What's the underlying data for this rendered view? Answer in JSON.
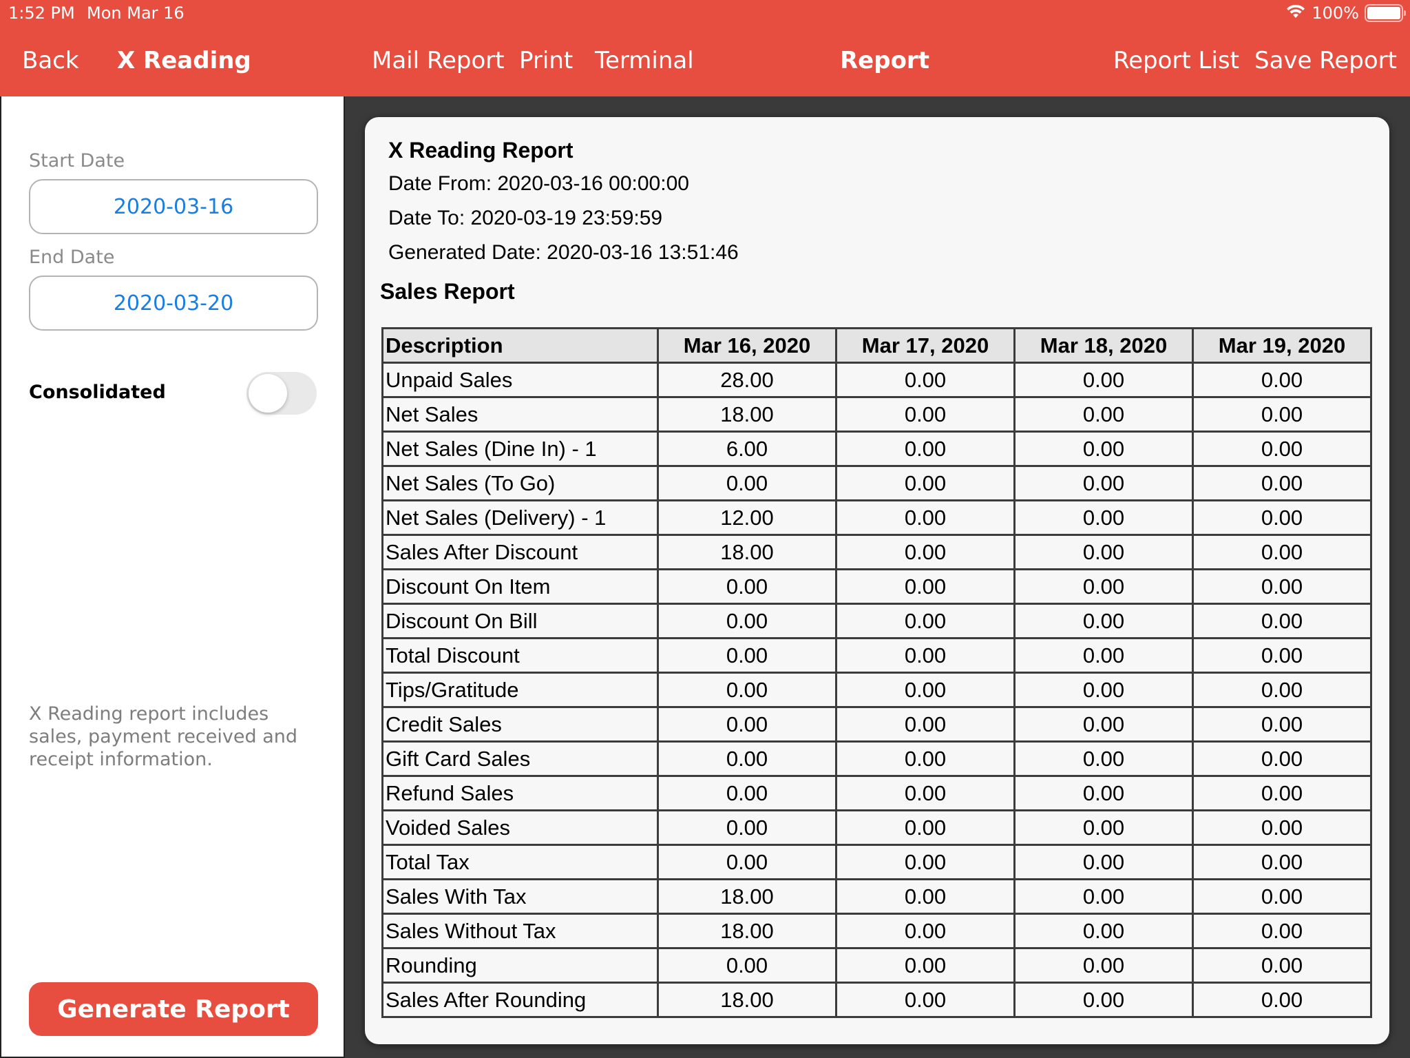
{
  "status_bar": {
    "time": "1:52 PM",
    "date": "Mon Mar 16",
    "battery": "100%",
    "battery_level_percent": 100,
    "wifi_icon": "wifi-icon",
    "battery_icon": "battery-icon"
  },
  "colors": {
    "accent": "#e84e40",
    "date_text": "#1a7ee0",
    "background_dark": "#3a3a3a"
  },
  "left_nav": {
    "back_label": "Back",
    "title": "X Reading"
  },
  "toolbar": {
    "mail_report": "Mail Report",
    "print": "Print",
    "terminal": "Terminal",
    "title": "Report",
    "report_list": "Report List",
    "save_report": "Save Report"
  },
  "left_panel": {
    "start_date_label": "Start Date",
    "start_date_value": "2020-03-16",
    "end_date_label": "End Date",
    "end_date_value": "2020-03-20",
    "consolidated_label": "Consolidated",
    "consolidated_on": false,
    "help_text": "X Reading report includes sales, payment received and receipt information.",
    "generate_button": "Generate Report"
  },
  "report": {
    "title": "X Reading Report",
    "date_from": "Date From: 2020-03-16 00:00:00",
    "date_to": "Date To: 2020-03-19 23:59:59",
    "generated": "Generated Date: 2020-03-16 13:51:46",
    "section_title": "Sales Report",
    "columns": [
      "Description",
      "Mar 16, 2020",
      "Mar 17, 2020",
      "Mar 18, 2020",
      "Mar 19, 2020"
    ],
    "rows": [
      [
        "Unpaid Sales",
        "28.00",
        "0.00",
        "0.00",
        "0.00"
      ],
      [
        "Net Sales",
        "18.00",
        "0.00",
        "0.00",
        "0.00"
      ],
      [
        "Net Sales (Dine In) - 1",
        "6.00",
        "0.00",
        "0.00",
        "0.00"
      ],
      [
        "Net Sales (To Go)",
        "0.00",
        "0.00",
        "0.00",
        "0.00"
      ],
      [
        "Net Sales (Delivery) - 1",
        "12.00",
        "0.00",
        "0.00",
        "0.00"
      ],
      [
        "Sales After Discount",
        "18.00",
        "0.00",
        "0.00",
        "0.00"
      ],
      [
        "Discount On Item",
        "0.00",
        "0.00",
        "0.00",
        "0.00"
      ],
      [
        "Discount On Bill",
        "0.00",
        "0.00",
        "0.00",
        "0.00"
      ],
      [
        "Total Discount",
        "0.00",
        "0.00",
        "0.00",
        "0.00"
      ],
      [
        "Tips/Gratitude",
        "0.00",
        "0.00",
        "0.00",
        "0.00"
      ],
      [
        "Credit Sales",
        "0.00",
        "0.00",
        "0.00",
        "0.00"
      ],
      [
        "Gift Card Sales",
        "0.00",
        "0.00",
        "0.00",
        "0.00"
      ],
      [
        "Refund Sales",
        "0.00",
        "0.00",
        "0.00",
        "0.00"
      ],
      [
        "Voided Sales",
        "0.00",
        "0.00",
        "0.00",
        "0.00"
      ],
      [
        "Total Tax",
        "0.00",
        "0.00",
        "0.00",
        "0.00"
      ],
      [
        "Sales With Tax",
        "18.00",
        "0.00",
        "0.00",
        "0.00"
      ],
      [
        "Sales Without Tax",
        "18.00",
        "0.00",
        "0.00",
        "0.00"
      ],
      [
        "Rounding",
        "0.00",
        "0.00",
        "0.00",
        "0.00"
      ],
      [
        "Sales After Rounding",
        "18.00",
        "0.00",
        "0.00",
        "0.00"
      ]
    ]
  }
}
